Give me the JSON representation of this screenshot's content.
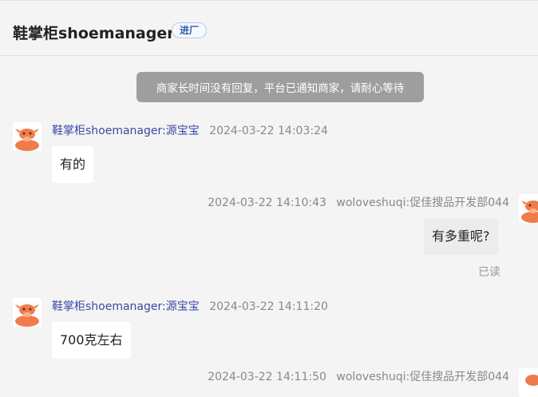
{
  "header": {
    "shop_name": "鞋掌柜shoemanager",
    "badge": "进厂"
  },
  "notice": "商家长时间没有回复，平台已通知商家，请耐心等待",
  "messages": [
    {
      "sender": "鞋掌柜shoemanager:源宝宝",
      "time": "2024-03-22 14:03:24",
      "text": "有的"
    },
    {
      "sender": "woloveshuqi:促佳搜品开发部044",
      "time": "2024-03-22 14:10:43",
      "text": "有多重呢?",
      "status": "已读"
    },
    {
      "sender": "鞋掌柜shoemanager:源宝宝",
      "time": "2024-03-22 14:11:20",
      "text": "700克左右"
    },
    {
      "sender": "woloveshuqi:促佳搜品开发部044",
      "time": "2024-03-22 14:11:50"
    }
  ],
  "colors": {
    "background": "#f4f4f4",
    "sender_name": "#3b4aa0",
    "notice_bg": "#9e9e9e",
    "avatar_orange": "#f07b4b"
  }
}
